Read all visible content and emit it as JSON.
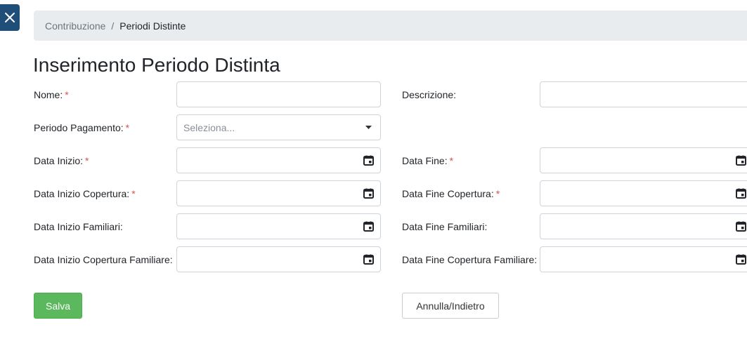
{
  "close_icon": "close-icon",
  "breadcrumb": {
    "parent": "Contribuzione",
    "separator": "/",
    "current": "Periodi Distinte"
  },
  "page_title": "Inserimento Periodo Distinta",
  "required_mark": "*",
  "fields": {
    "nome": {
      "label": "Nome:",
      "required": true,
      "value": ""
    },
    "descrizione": {
      "label": "Descrizione:",
      "required": false,
      "value": ""
    },
    "periodo_pagamento": {
      "label": "Periodo Pagamento:",
      "required": true,
      "placeholder": "Seleziona..."
    },
    "data_inizio": {
      "label": "Data Inizio:",
      "required": true,
      "value": ""
    },
    "data_fine": {
      "label": "Data Fine:",
      "required": true,
      "value": ""
    },
    "data_inizio_copertura": {
      "label": "Data Inizio Copertura:",
      "required": true,
      "value": ""
    },
    "data_fine_copertura": {
      "label": "Data Fine Copertura:",
      "required": true,
      "value": ""
    },
    "data_inizio_familiari": {
      "label": "Data Inizio Familiari:",
      "required": false,
      "value": ""
    },
    "data_fine_familiari": {
      "label": "Data Fine Familiari:",
      "required": false,
      "value": ""
    },
    "data_inizio_copertura_familiare": {
      "label": "Data Inizio Copertura Familiare:",
      "required": false,
      "value": ""
    },
    "data_fine_copertura_familiare": {
      "label": "Data Fine Copertura Familiare:",
      "required": false,
      "value": ""
    }
  },
  "buttons": {
    "save": "Salva",
    "cancel": "Annulla/Indietro"
  },
  "colors": {
    "primary_dark": "#1f4e79",
    "success": "#5cb85c",
    "required": "#d9534f",
    "breadcrumb_bg": "#e9ecef"
  }
}
